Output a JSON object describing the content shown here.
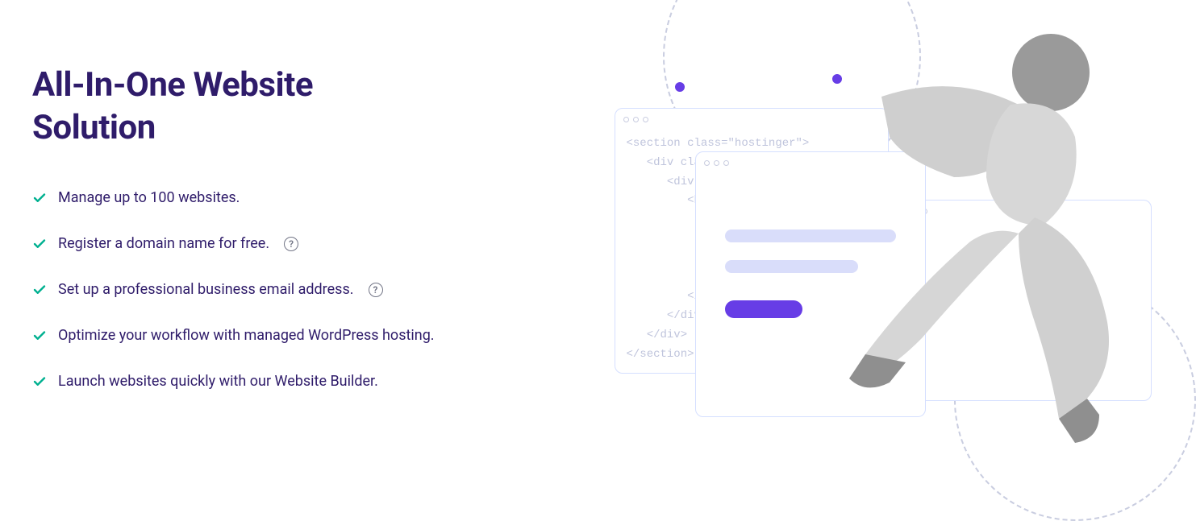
{
  "heading": "All-In-One Website Solution",
  "features": [
    {
      "text": "Manage up to 100 websites.",
      "help": false
    },
    {
      "text": "Register a domain name for free.",
      "help": true
    },
    {
      "text": "Set up a professional business email address.",
      "help": true
    },
    {
      "text": "Optimize your workflow with managed WordPress hosting.",
      "help": false
    },
    {
      "text": "Launch websites quickly with our Website Builder.",
      "help": false
    }
  ],
  "illustration": {
    "code_lines": "<section class=\"hostinger\">\n   <div class\n      <div cl\n         <h1>\n            <u\n\n\n\n         </div>\n      </div>\n   </div>\n</section>",
    "help_symbol": "?"
  },
  "colors": {
    "accent": "#673DE6",
    "heading": "#2F1C6A",
    "check": "#00B090"
  }
}
